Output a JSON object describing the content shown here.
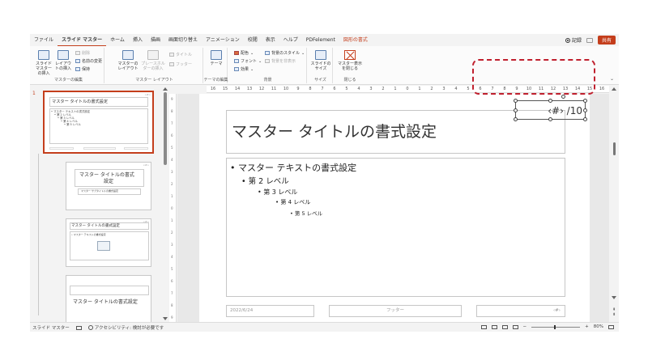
{
  "tabs": [
    {
      "label": "ファイル",
      "active": false
    },
    {
      "label": "スライド マスター",
      "active": true
    },
    {
      "label": "ホーム",
      "active": false
    },
    {
      "label": "挿入",
      "active": false
    },
    {
      "label": "描画",
      "active": false
    },
    {
      "label": "画面切り替え",
      "active": false
    },
    {
      "label": "アニメーション",
      "active": false
    },
    {
      "label": "校閲",
      "active": false
    },
    {
      "label": "表示",
      "active": false
    },
    {
      "label": "ヘルプ",
      "active": false
    },
    {
      "label": "PDFelement",
      "active": false
    },
    {
      "label": "図形の書式",
      "active": false
    }
  ],
  "tabs_right": {
    "record": "記録",
    "share": "共有"
  },
  "ribbon": {
    "edit_master": {
      "label": "マスターの編集",
      "insert_master": "スライド マスターの挿入",
      "insert_layout": "レイアウトの挿入",
      "delete": "削除",
      "rename": "名前の変更",
      "preserve": "保持"
    },
    "master_layout": {
      "label": "マスター レイアウト",
      "master_layout_btn": "マスターのレイアウト",
      "insert_placeholder": "プレースホルダーの挿入",
      "title": "タイトル",
      "footer": "フッター"
    },
    "theme": {
      "label": "テーマの編集",
      "theme_btn": "テーマ"
    },
    "background": {
      "label": "背景",
      "colors": "配色",
      "fonts": "フォント",
      "effects": "効果",
      "bg_styles": "背景のスタイル",
      "hide_bg": "背景を非表示"
    },
    "size": {
      "label": "サイズ",
      "slide_size": "スライドのサイズ"
    },
    "close": {
      "label": "閉じる",
      "close_master": "マスター表示を閉じる"
    }
  },
  "thumbnails": {
    "number": "1",
    "master": {
      "title": "マスター タイトルの書式設定",
      "text_lines": [
        "• マスター テキストの書式設定",
        "• 第 2 レベル",
        "• 第 3 レベル",
        "• 第 4 レベル",
        "• 第 5 レベル"
      ]
    },
    "layout1": {
      "title_line1": "マスター タイトルの書式",
      "title_line2": "設定",
      "subtitle": "マスター サブタイトルの書式設定"
    },
    "layout2": {
      "title": "マスター タイトルの書式設定",
      "text": "• マスター テキストの書式設定"
    },
    "layout3": {
      "title": "マスター タイトルの書式設定"
    },
    "num_marker": "<#>"
  },
  "ruler": {
    "labels": [
      "16",
      "15",
      "14",
      "13",
      "12",
      "11",
      "10",
      "9",
      "8",
      "7",
      "6",
      "5",
      "4",
      "3",
      "2",
      "1",
      "0",
      "1",
      "2",
      "3",
      "4",
      "5",
      "6",
      "7",
      "8",
      "9",
      "10",
      "11",
      "12",
      "13",
      "14",
      "15",
      "16"
    ]
  },
  "slide": {
    "title": "マスター タイトルの書式設定",
    "bullets": [
      "• マスター テキストの書式設定",
      "• 第 2 レベル",
      "• 第 3 レベル",
      "• 第 4 レベル",
      "• 第 5 レベル"
    ],
    "date": "2022/6/24",
    "footer": "フッター",
    "slide_num": "‹#›",
    "num_placeholder_text": "‹#› /10"
  },
  "status": {
    "mode": "スライド マスター",
    "accessibility": "アクセシビリティ: 検討が必要です",
    "zoom": "80%"
  },
  "colors": {
    "accent": "#c43e1c",
    "highlight": "#c0202e"
  }
}
